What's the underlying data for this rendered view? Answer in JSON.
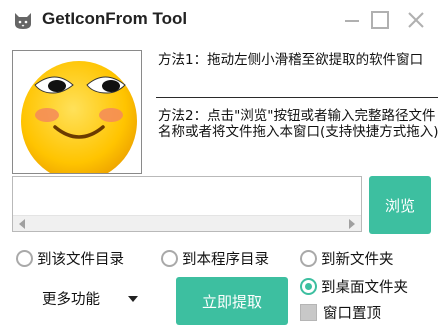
{
  "window": {
    "title": "GetIconFrom Tool",
    "icons": {
      "app": "cat-icon",
      "minimize": "minimize-icon",
      "maximize": "maximize-icon",
      "close": "close-icon"
    }
  },
  "preview": {
    "icon": "smiley-face-icon"
  },
  "instructions": {
    "method1": "方法1：拖动左侧小滑稽至欲提取的软件窗口",
    "method2": "方法2：点击\"浏览\"按钮或者输入完整路径文件名称或者将文件拖入本窗口(支持快捷方式拖入)"
  },
  "path": {
    "value": "",
    "placeholder": ""
  },
  "buttons": {
    "browse": "浏览",
    "extract": "立即提取"
  },
  "options": {
    "to_file_dir": "到该文件目录",
    "to_program_dir": "到本程序目录",
    "to_new_folder": "到新文件夹",
    "to_desktop_folder": "到桌面文件夹",
    "selected": "to_desktop_folder"
  },
  "window_on_top": {
    "label": "窗口置顶",
    "checked": false
  },
  "more": {
    "label": "更多功能",
    "icon": "caret-down-icon"
  },
  "colors": {
    "accent": "#3dbfa0",
    "text": "#1a1a1a",
    "title_icon": "#555555"
  }
}
